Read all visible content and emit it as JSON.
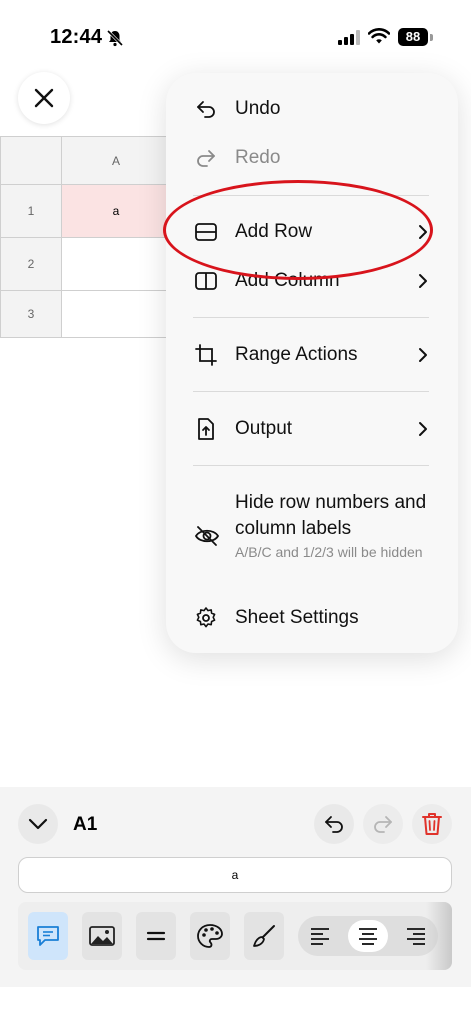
{
  "status_bar": {
    "time": "12:44",
    "battery": "88"
  },
  "sheet": {
    "column_headers": [
      "A"
    ],
    "row_headers": [
      "1",
      "2",
      "3"
    ],
    "cells": {
      "A1": "a"
    }
  },
  "menu": {
    "items": [
      {
        "label": "Undo",
        "icon": "undo-icon"
      },
      {
        "label": "Redo",
        "icon": "redo-icon"
      },
      {
        "label": "Add Row",
        "icon": "add-row-icon"
      },
      {
        "label": "Add Column",
        "icon": "add-column-icon"
      },
      {
        "label": "Range Actions",
        "icon": "crop-icon"
      },
      {
        "label": "Output",
        "icon": "export-icon"
      },
      {
        "label": "Sheet Settings",
        "icon": "gear-icon"
      }
    ],
    "hide_labels": {
      "title": "Hide row numbers and column labels",
      "subtitle": "A/B/C and 1/2/3 will be hidden"
    }
  },
  "editor": {
    "cell_ref": "A1",
    "formula_value": "a"
  },
  "colors": {
    "annotation": "#d8141c",
    "accent": "#1a7fd6",
    "delete": "#e0332b"
  }
}
